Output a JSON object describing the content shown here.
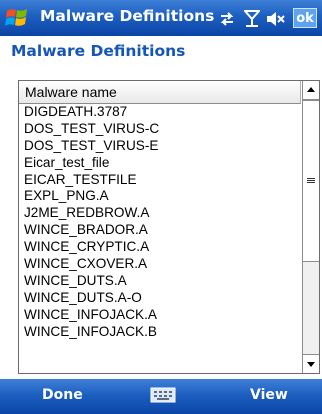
{
  "titlebar": {
    "app_title": "Malware Definitions",
    "ok_label": "ok"
  },
  "page": {
    "heading": "Malware Definitions"
  },
  "list": {
    "column_header": "Malware name",
    "items": [
      "DIGDEATH.3787",
      "DOS_TEST_VIRUS-C",
      "DOS_TEST_VIRUS-E",
      "Eicar_test_file",
      "EICAR_TESTFILE",
      "EXPL_PNG.A",
      "J2ME_REDBROW.A",
      "WINCE_BRADOR.A",
      "WINCE_CRYPTIC.A",
      "WINCE_CXOVER.A",
      "WINCE_DUTS.A",
      "WINCE_DUTS.A-O",
      "WINCE_INFOJACK.A",
      "WINCE_INFOJACK.B"
    ]
  },
  "menubar": {
    "left_label": "Done",
    "right_label": "View"
  },
  "icons": {
    "start": "windows-flag-icon",
    "connectivity": "connectivity-arrows-icon",
    "signal": "signal-antenna-icon",
    "volume": "speaker-muted-icon",
    "keyboard": "keyboard-icon"
  },
  "colors": {
    "bar": "#1d5fc0",
    "heading": "#1557b8",
    "ok_button": "#5da3ee"
  }
}
